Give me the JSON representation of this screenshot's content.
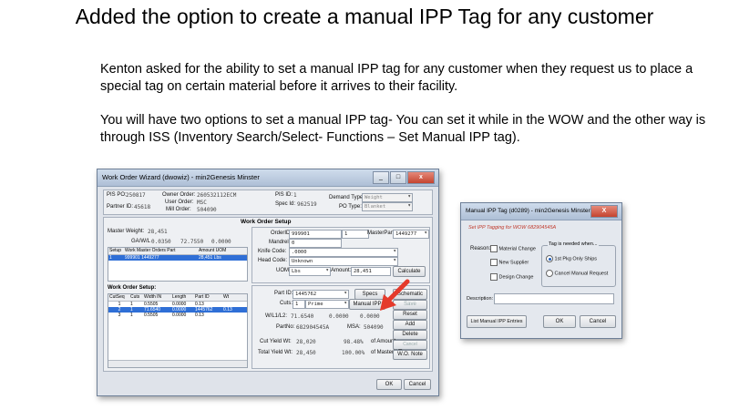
{
  "slide": {
    "title": "Added the option to create a manual IPP Tag for any customer",
    "paragraph1": "Kenton asked for the ability to set a manual IPP tag for any customer when they request us to place a special tag on certain material before it arrives to their facility.",
    "paragraph2": "You will have two options to set a manual IPP tag- You can set it while in the WOW and the other way is through ISS (Inventory Search/Select- Functions – Set Manual IPP tag)."
  },
  "wow": {
    "title": "Work Order Wizard (dwowiz) - min2Genesis Minster",
    "pis_po_label": "PIS PO:",
    "pis_po": "250817",
    "owner_order_label": "Owner Order:",
    "owner_order": "260532112ECM",
    "user_order_label": "User Order:",
    "user_order": "MSC",
    "partner_id_label": "Partner ID:",
    "partner_id": "45618",
    "mill_order_label": "Mill Order:",
    "mill_order": "504090",
    "pis_id_label": "PIS ID:",
    "pis_id": "1",
    "spec_id_label": "Spec Id:",
    "spec_id": "962519",
    "demand_type_label": "Demand Type:",
    "demand_type": "Weight",
    "po_type_label": "PO Type:",
    "po_type": "Blanket",
    "setup_header": "Work Order Setup",
    "master_weight_label": "Master Weight:",
    "master_weight": "28,451",
    "gawl_label": "GA/W/L",
    "gawl_ga": "0.0350",
    "gawl_w": "72.7550",
    "gawl_l": "0.0000",
    "master_grid": {
      "headers": [
        "Setup",
        "Work Master Orders Part",
        "Amount UOM"
      ],
      "rows": [
        [
          "1",
          "999901 1449277",
          "28,451 Lbs"
        ]
      ]
    },
    "order_id_label": "OrderID:",
    "order_id": "999901",
    "order_seq": "1",
    "master_part_label": "MasterPartID:",
    "master_part": "1449277",
    "mandrel_label": "Mandrel:",
    "mandrel": "0",
    "knife_code_label": "Knife Code:",
    "knife_code": ".0000",
    "head_code_label": "Head Code:",
    "head_code": "Unknown",
    "uom_label": "UOM:",
    "uom": "Lbs",
    "amount_label": "Amount:",
    "amount": "28,451",
    "calculate_button": "Calculate",
    "wo_setup_label": "Work Order Setup:",
    "wo_grid": {
      "headers": [
        "CutSeq",
        "Cuts",
        "Width IN",
        "Length",
        "Part ID",
        "Wt"
      ],
      "rows": [
        [
          "1",
          "1",
          "0.5505",
          "0.0000",
          "0.13",
          ""
        ],
        [
          "2",
          "1",
          "71.6540",
          "0.0000",
          "1445762",
          "0.13"
        ],
        [
          "3",
          "1",
          "0.5505",
          "0.0000",
          "0.13",
          ""
        ]
      ],
      "selected_row": 1
    },
    "part_id_label": "Part ID:",
    "part_id": "1445762",
    "specs_button": "Specs",
    "schematic_button": "Schematic",
    "cuts_label": "Cuts:",
    "cuts": "1",
    "cut_type": "Prime",
    "manual_ipp_button": "Manual IPP",
    "save_button": "Save",
    "wl_label": "W/L1/L2:",
    "wl_w": "71.6540",
    "wl_l1": "0.0000",
    "wl_l2": "0.0000",
    "partno_label": "PartNo:",
    "partno": "682904545A",
    "msa_label": "MSA:",
    "msa": "504090",
    "reset_button": "Reset",
    "add_button": "Add",
    "delete_button": "Delete",
    "cancel_side_button": "Cancel",
    "cut_yield_label": "Cut Yield Wt:",
    "cut_yield": "28,020",
    "cut_yield_pct": "98.48%",
    "cut_yield_of": "of Amount",
    "total_yield_label": "Total Yield Wt:",
    "total_yield": "28,450",
    "total_yield_pct": "100.00%",
    "total_yield_of": "of MasterWT",
    "wo_note_button": "W.O. Note",
    "ok_button": "OK",
    "cancel_button": "Cancel"
  },
  "ipp": {
    "title": "Manual IPP Tag (d0289) - min2Genesis Minster",
    "close": "X",
    "subtitle": "Set IPP Tagging for WOW 682904545A",
    "reason_label": "Reason:",
    "material_change": "Material Change",
    "new_supplier": "New Supplier",
    "design_change": "Design Change",
    "group_label": "Tag is needed when...",
    "opt1": "1st Pkg Only Ships",
    "opt2": "Cancel Manual Request",
    "description_label": "Description:",
    "description": "",
    "list_button": "List Manual IPP Entries",
    "ok_button": "OK",
    "cancel_button": "Cancel"
  },
  "colors": {
    "arrow": "#e53a2b",
    "selection": "#2f6fd6",
    "subtitle": "#c0392b"
  }
}
